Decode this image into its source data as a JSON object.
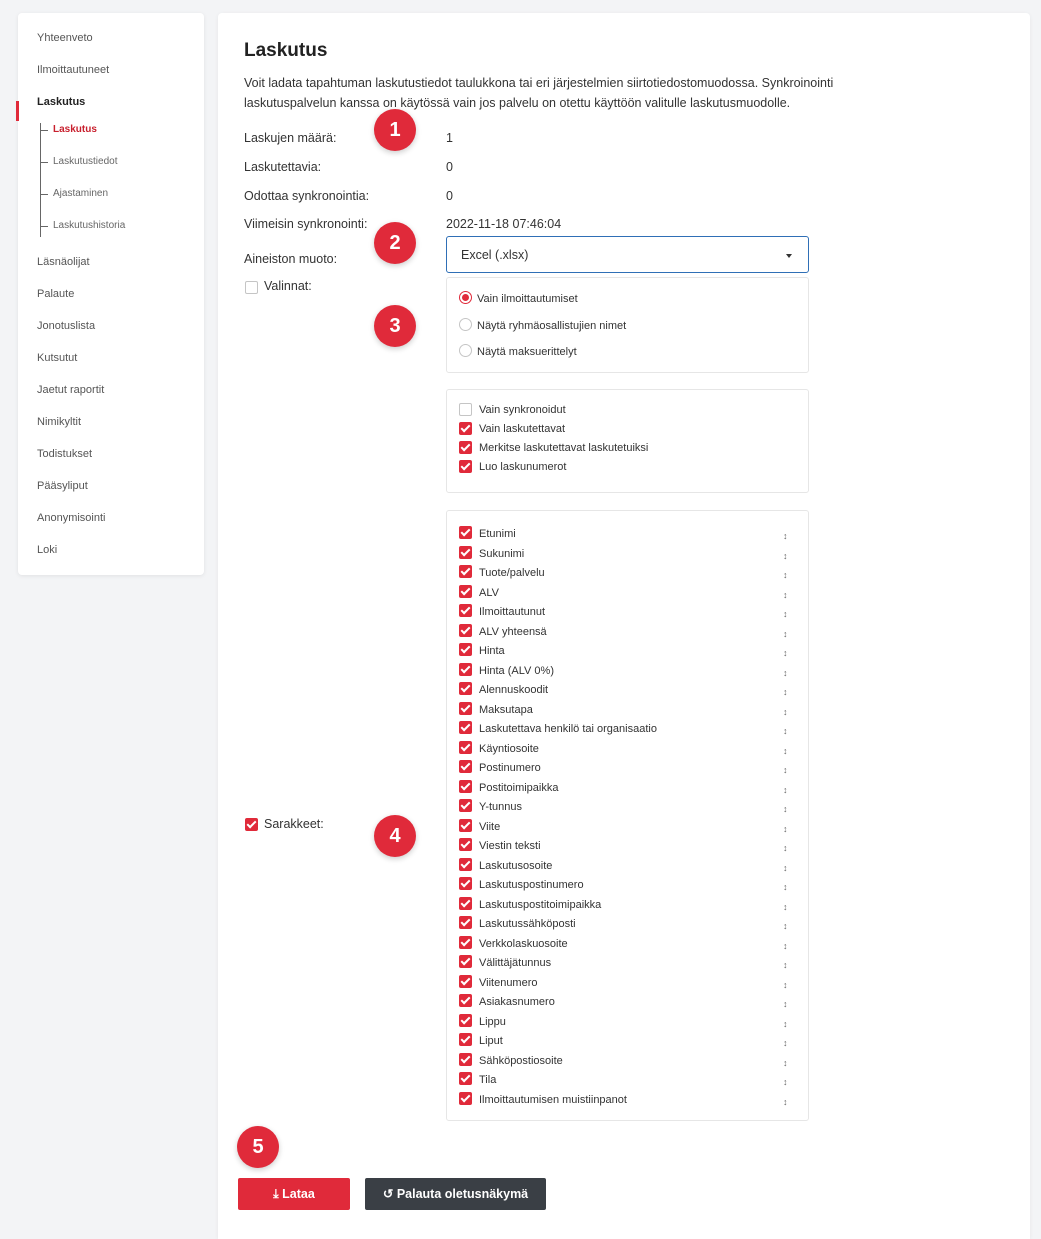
{
  "sidebar": {
    "items": [
      "Yhteenveto",
      "Ilmoittautuneet",
      "Laskutus",
      "Läsnäolijat",
      "Palaute",
      "Jonotuslista",
      "Kutsutut",
      "Jaetut raportit",
      "Nimikyltit",
      "Todistukset",
      "Pääsyliput",
      "Anonymisointi",
      "Loki"
    ],
    "subitems": [
      "Laskutus",
      "Laskutustiedot",
      "Ajastaminen",
      "Laskutushistoria"
    ]
  },
  "main": {
    "title": "Laskutus",
    "description": "Voit ladata tapahtuman laskutustiedot taulukkona tai eri järjestelmien siirtotiedostomuodossa. Synkroinointi laskutuspalvelun kanssa on käytössä vain jos palvelu on otettu käyttöön valitulle laskutusmuodolle.",
    "stats": [
      {
        "label": "Laskujen määrä:",
        "value": "1"
      },
      {
        "label": "Laskutettavia:",
        "value": "0"
      },
      {
        "label": "Odottaa synkronointia:",
        "value": "0"
      },
      {
        "label": "Viimeisin synkronointi:",
        "value": "2022-11-18 07:46:04"
      }
    ],
    "format_label": "Aineiston muoto:",
    "format_value": "Excel (.xlsx)",
    "options_label": "Valinnat:",
    "radio_options": [
      "Vain ilmoittautumiset",
      "Näytä ryhmäosallistujien nimet",
      "Näytä maksuerittelyt"
    ],
    "check_options": [
      {
        "label": "Vain synkronoidut",
        "checked": false
      },
      {
        "label": "Vain laskutettavat",
        "checked": true
      },
      {
        "label": "Merkitse laskutettavat laskutetuiksi",
        "checked": true
      },
      {
        "label": "Luo laskunumerot",
        "checked": true
      }
    ],
    "columns_label": "Sarakkeet:",
    "columns": [
      "Etunimi",
      "Sukunimi",
      "Tuote/palvelu",
      "ALV",
      "Ilmoittautunut",
      "ALV yhteensä",
      "Hinta",
      "Hinta (ALV 0%)",
      "Alennuskoodit",
      "Maksutapa",
      "Laskutettava henkilö tai organisaatio",
      "Käyntiosoite",
      "Postinumero",
      "Postitoimipaikka",
      "Y-tunnus",
      "Viite",
      "Viestin teksti",
      "Laskutusosoite",
      "Laskutuspostinumero",
      "Laskutuspostitoimipaikka",
      "Laskutussähköposti",
      "Verkkolaskuosoite",
      "Välittäjätunnus",
      "Viitenumero",
      "Asiakasnumero",
      "Lippu",
      "Liput",
      "Sähköpostiosoite",
      "Tila",
      "Ilmoittautumisen muistiinpanot"
    ],
    "badges": [
      "1",
      "2",
      "3",
      "4",
      "5"
    ],
    "download_label": "Lataa",
    "reset_label": "Palauta oletusnäkymä"
  }
}
